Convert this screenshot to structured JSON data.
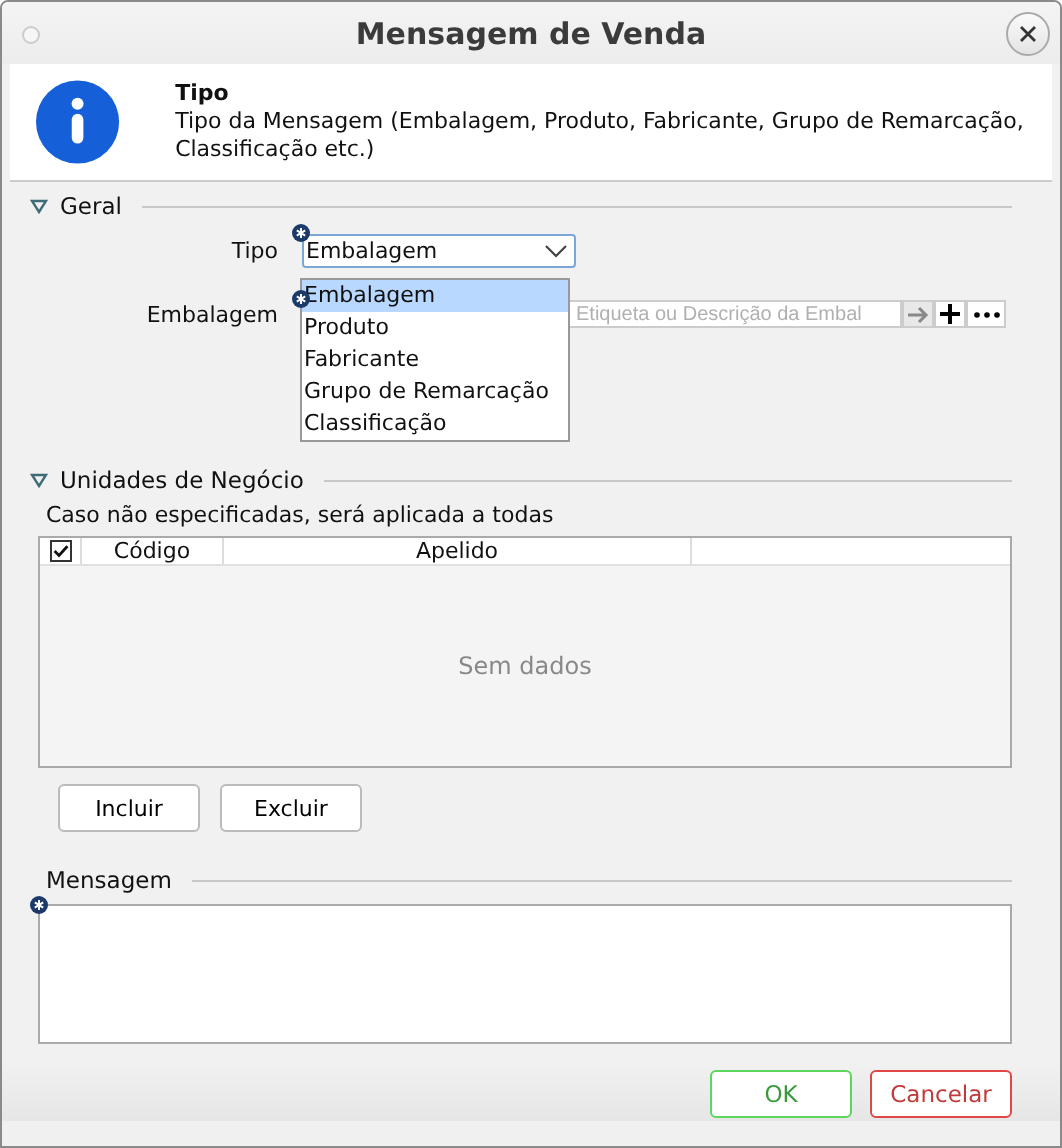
{
  "window": {
    "title": "Mensagem de Venda"
  },
  "info": {
    "title": "Tipo",
    "description": "Tipo da Mensagem (Embalagem, Produto, Fabricante, Grupo de Remarcação, Classificação etc.)"
  },
  "geral": {
    "title": "Geral",
    "expanded": true,
    "fields": [
      {
        "label": "Tipo",
        "kind": "select",
        "value": "Embalagem",
        "required": true
      },
      {
        "label": "Embalagem",
        "kind": "lookup",
        "placeholder": "Etiqueta ou Descrição da Embal",
        "required": true
      }
    ]
  },
  "dropdown": {
    "options": [
      {
        "label": "Embalagem",
        "selected": true
      },
      {
        "label": "Produto",
        "selected": false
      },
      {
        "label": "Fabricante",
        "selected": false
      },
      {
        "label": "Grupo de Remarcação",
        "selected": false
      },
      {
        "label": "Classificação",
        "selected": false
      }
    ]
  },
  "unidades": {
    "title": "Unidades de Negócio",
    "expanded": true,
    "note": "Caso não especificadas, será aplicada a todas",
    "table": {
      "select_all_checked": true,
      "columns": [
        "Código",
        "Apelido"
      ],
      "empty_text": "Sem dados"
    },
    "buttons": [
      "Incluir",
      "Excluir"
    ]
  },
  "mensagem": {
    "title": "Mensagem",
    "required": true
  },
  "buttons": [
    {
      "label": "OK",
      "kind": "ok"
    },
    {
      "label": "Cancelar",
      "kind": "cancel"
    }
  ]
}
